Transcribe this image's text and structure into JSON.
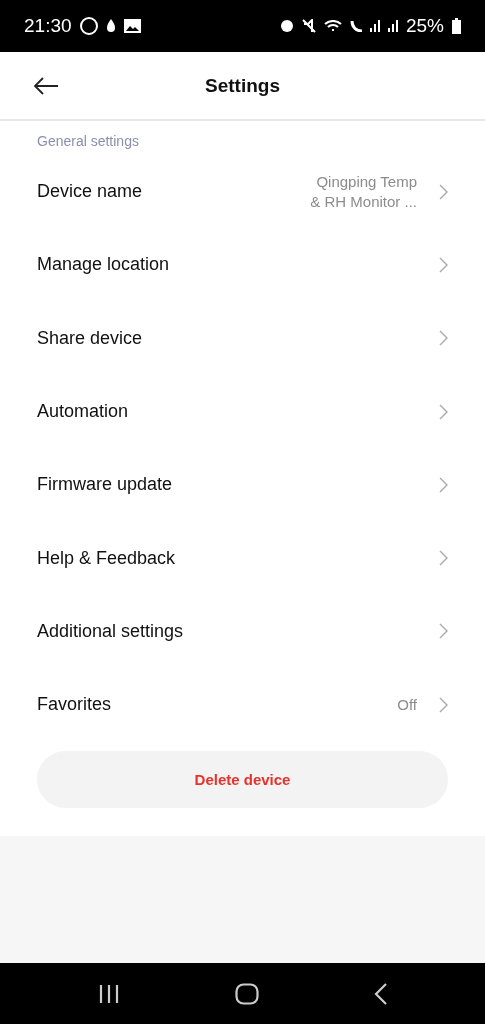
{
  "status_bar": {
    "time": "21:30",
    "battery": "25%"
  },
  "header": {
    "title": "Settings"
  },
  "section": {
    "title": "General settings"
  },
  "rows": [
    {
      "label": "Device name",
      "value": "Qingping Temp & RH Monitor ..."
    },
    {
      "label": "Manage location"
    },
    {
      "label": "Share device"
    },
    {
      "label": "Automation"
    },
    {
      "label": "Firmware update"
    },
    {
      "label": "Help & Feedback"
    },
    {
      "label": "Additional settings"
    },
    {
      "label": "Favorites",
      "value": "Off"
    }
  ],
  "delete_button": {
    "label": "Delete device"
  }
}
